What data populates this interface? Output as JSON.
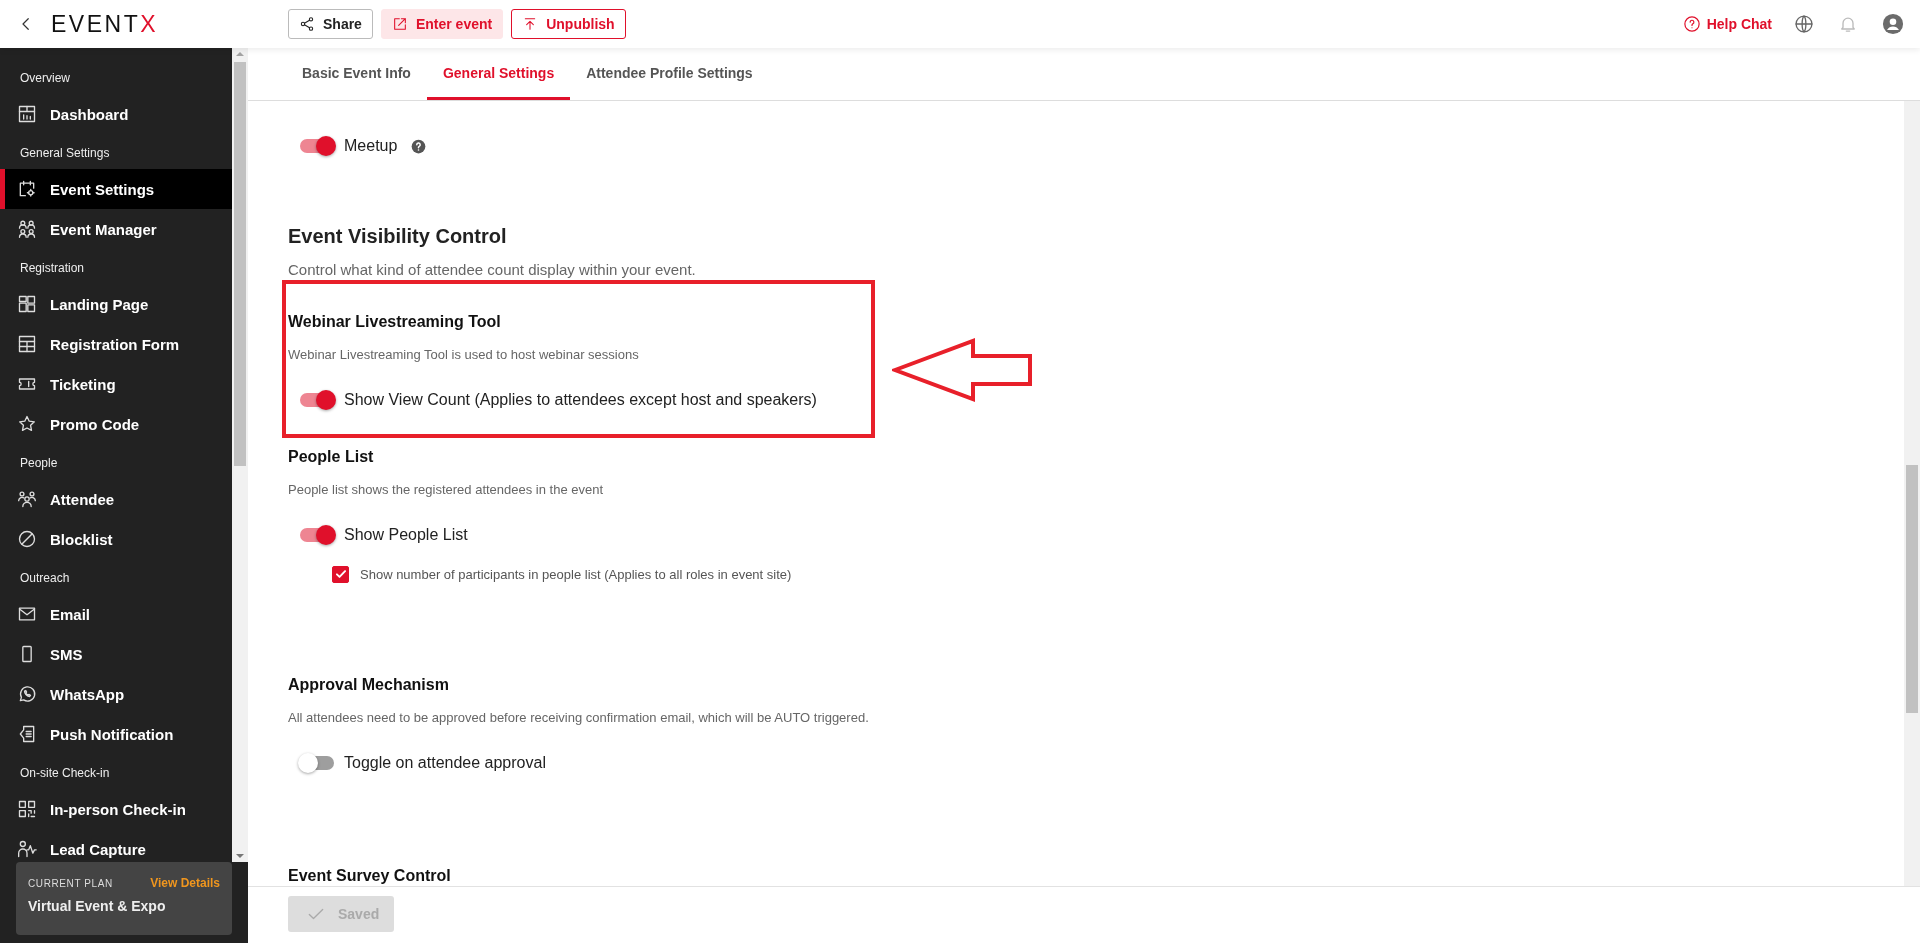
{
  "topbar": {
    "logo": {
      "main": "EVENT",
      "accent": "X"
    },
    "actions": [
      {
        "kind": "outline",
        "label": "Share"
      },
      {
        "kind": "tinted",
        "label": "Enter event"
      },
      {
        "kind": "danger",
        "label": "Unpublish"
      }
    ],
    "help": "Help Chat"
  },
  "sidebar": {
    "items": [
      {
        "kind": "section",
        "label": "Overview"
      },
      {
        "kind": "item",
        "label": "Dashboard",
        "selected": false
      },
      {
        "kind": "section",
        "label": "General Settings"
      },
      {
        "kind": "item",
        "label": "Event Settings",
        "selected": true
      },
      {
        "kind": "item",
        "label": "Event Manager",
        "selected": false
      },
      {
        "kind": "section",
        "label": "Registration"
      },
      {
        "kind": "item",
        "label": "Landing Page",
        "selected": false
      },
      {
        "kind": "item",
        "label": "Registration Form",
        "selected": false
      },
      {
        "kind": "item",
        "label": "Ticketing",
        "selected": false
      },
      {
        "kind": "item",
        "label": "Promo Code",
        "selected": false
      },
      {
        "kind": "section",
        "label": "People"
      },
      {
        "kind": "item",
        "label": "Attendee",
        "selected": false
      },
      {
        "kind": "item",
        "label": "Blocklist",
        "selected": false
      },
      {
        "kind": "section",
        "label": "Outreach"
      },
      {
        "kind": "item",
        "label": "Email",
        "selected": false
      },
      {
        "kind": "item",
        "label": "SMS",
        "selected": false
      },
      {
        "kind": "item",
        "label": "WhatsApp",
        "selected": false
      },
      {
        "kind": "item",
        "label": "Push Notification",
        "selected": false
      },
      {
        "kind": "section",
        "label": "On-site Check-in"
      },
      {
        "kind": "item",
        "label": "In-person Check-in",
        "selected": false
      },
      {
        "kind": "item",
        "label": "Lead Capture",
        "selected": false
      }
    ],
    "plan": {
      "caption": "CURRENT PLAN",
      "link": "View Details",
      "name": "Virtual Event & Expo"
    }
  },
  "tabs": [
    {
      "label": "Basic Event Info",
      "selected": false
    },
    {
      "label": "General Settings",
      "selected": true
    },
    {
      "label": "Attendee Profile Settings",
      "selected": false
    }
  ],
  "content": [
    {
      "kind": "option",
      "option": {
        "kind": "toggle",
        "label": "Meetup",
        "on": true,
        "help": true
      }
    },
    {
      "kind": "heading",
      "title": "Event Visibility Control",
      "subtitle": "Control what kind of attendee count display within your event."
    },
    {
      "kind": "subsection",
      "title": "Webinar Livestreaming Tool",
      "description": "Webinar Livestreaming Tool is used to host webinar sessions",
      "highlighted": true,
      "options": [
        {
          "kind": "toggle",
          "label": "Show View Count (Applies to attendees except host and speakers)",
          "on": true
        }
      ]
    },
    {
      "kind": "subsection",
      "title": "People List",
      "description": "People list shows the registered attendees in the event",
      "highlighted": false,
      "options": [
        {
          "kind": "toggle",
          "label": "Show People List",
          "on": true
        },
        {
          "kind": "checkbox",
          "label": "Show number of participants in people list (Applies to all roles in event site)",
          "checked": true
        }
      ]
    },
    {
      "kind": "section",
      "title": "Approval Mechanism",
      "description": "All attendees need to be approved before receiving confirmation email, which will be AUTO triggered.",
      "highlighted": false,
      "options": [
        {
          "kind": "toggle",
          "label": "Toggle on attendee approval",
          "on": false
        }
      ]
    },
    {
      "kind": "section",
      "title": "Event Survey Control",
      "highlighted": false
    }
  ],
  "footer": {
    "save": {
      "label": "Saved",
      "disabled": true
    }
  }
}
